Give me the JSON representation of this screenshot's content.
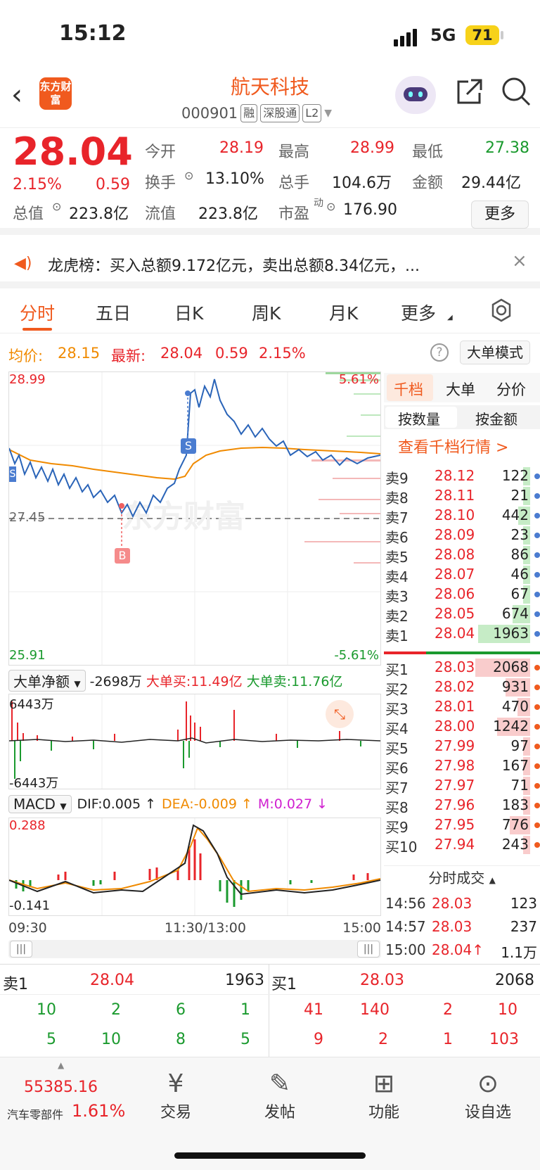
{
  "status": {
    "time": "15:12",
    "network": "5G",
    "battery": "71"
  },
  "header": {
    "logo": "东方财富",
    "name": "航天科技",
    "code": "000901",
    "tags": [
      "融",
      "深股通",
      "L2"
    ]
  },
  "quote": {
    "price": "28.04",
    "pct": "2.15%",
    "chg": "0.59",
    "open_label": "今开",
    "open": "28.19",
    "high_label": "最高",
    "high": "28.99",
    "low_label": "最低",
    "low": "27.38",
    "turnover_label": "换手",
    "turnover": "13.10%",
    "vol_label": "总手",
    "vol": "104.6万",
    "amt_label": "金额",
    "amt": "29.44亿",
    "mcap_label": "总值",
    "mcap": "223.8亿",
    "float_label": "流值",
    "float": "223.8亿",
    "pe_label": "市盈",
    "pe_sup": "动",
    "pe": "176.90",
    "more": "更多"
  },
  "news": {
    "text": "龙虎榜：买入总额9.172亿元，卖出总额8.34亿元，..."
  },
  "tabs": [
    "分时",
    "五日",
    "日K",
    "周K",
    "月K",
    "更多"
  ],
  "info": {
    "avg_label": "均价:",
    "avg": "28.15",
    "last_label": "最新:",
    "last": "28.04",
    "chg": "0.59",
    "pct": "2.15%",
    "mode": "大单模式"
  },
  "chart": {
    "ymax": "28.99",
    "ymin": "25.91",
    "ref": "27.45",
    "pmax": "5.61%",
    "pmin": "-5.61%",
    "watermark": "东方财富",
    "marker_b": "B",
    "marker_s": "S",
    "marker_s2": "S"
  },
  "net": {
    "select": "大单净额",
    "value": "-2698万",
    "buy": "大单买:11.49亿",
    "sell": "大单卖:11.76亿",
    "max": "6443万",
    "min": "-6443万"
  },
  "macd": {
    "select": "MACD",
    "dif": "DIF:0.005 ↑",
    "dea": "DEA:-0.009 ↑",
    "m": "M:0.027 ↓",
    "max": "0.288",
    "min": "-0.141"
  },
  "times": {
    "start": "09:30",
    "mid": "11:30/13:00",
    "end": "15:00"
  },
  "right": {
    "tabs": [
      "千档",
      "大单",
      "分价"
    ],
    "sub": [
      "按数量",
      "按金额"
    ],
    "link": "查看千档行情 >",
    "asks": [
      {
        "l": "卖9",
        "p": "28.12",
        "v": "122"
      },
      {
        "l": "卖8",
        "p": "28.11",
        "v": "21"
      },
      {
        "l": "卖7",
        "p": "28.10",
        "v": "442"
      },
      {
        "l": "卖6",
        "p": "28.09",
        "v": "23"
      },
      {
        "l": "卖5",
        "p": "28.08",
        "v": "86"
      },
      {
        "l": "卖4",
        "p": "28.07",
        "v": "46"
      },
      {
        "l": "卖3",
        "p": "28.06",
        "v": "67"
      },
      {
        "l": "卖2",
        "p": "28.05",
        "v": "674"
      },
      {
        "l": "卖1",
        "p": "28.04",
        "v": "1963"
      }
    ],
    "bids": [
      {
        "l": "买1",
        "p": "28.03",
        "v": "2068"
      },
      {
        "l": "买2",
        "p": "28.02",
        "v": "931"
      },
      {
        "l": "买3",
        "p": "28.01",
        "v": "470"
      },
      {
        "l": "买4",
        "p": "28.00",
        "v": "1242"
      },
      {
        "l": "买5",
        "p": "27.99",
        "v": "97"
      },
      {
        "l": "买6",
        "p": "27.98",
        "v": "167"
      },
      {
        "l": "买7",
        "p": "27.97",
        "v": "71"
      },
      {
        "l": "买8",
        "p": "27.96",
        "v": "183"
      },
      {
        "l": "买9",
        "p": "27.95",
        "v": "776"
      },
      {
        "l": "买10",
        "p": "27.94",
        "v": "243"
      }
    ],
    "trades_title": "分时成交",
    "trades": [
      {
        "t": "14:56",
        "p": "28.03",
        "v": "123"
      },
      {
        "t": "14:57",
        "p": "28.03",
        "v": "237"
      },
      {
        "t": "15:00",
        "p": "28.04↑",
        "v": "1.1万"
      }
    ]
  },
  "book": {
    "ask_label": "卖1",
    "ask_price": "28.04",
    "ask_vol": "1963",
    "bid_label": "买1",
    "bid_price": "28.03",
    "bid_vol": "2068",
    "ask_q1": [
      "10",
      "2",
      "6",
      "1"
    ],
    "ask_q2": [
      "5",
      "10",
      "8",
      "5"
    ],
    "bid_q1": [
      "41",
      "140",
      "2",
      "10"
    ],
    "bid_q2": [
      "9",
      "2",
      "1",
      "103"
    ]
  },
  "footer": {
    "index": "55385.16",
    "sector": "汽车零部件",
    "sector_pct": "1.61%",
    "items": [
      "交易",
      "发帖",
      "功能",
      "设自选"
    ]
  }
}
